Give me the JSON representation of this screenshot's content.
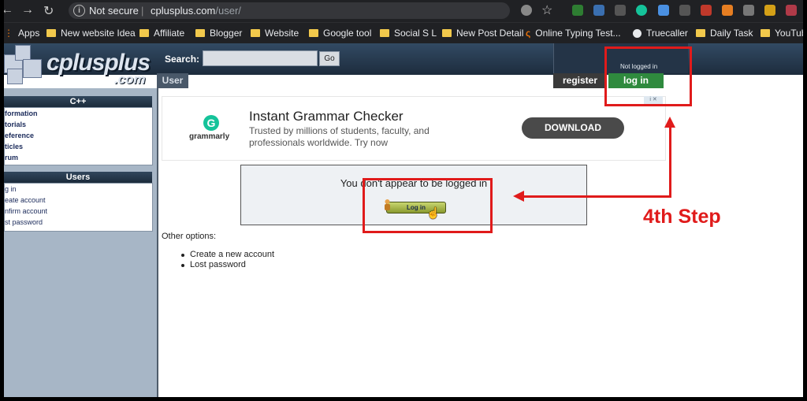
{
  "browser": {
    "security_label": "Not secure",
    "url_host": "cplusplus.com",
    "url_path": "/user/",
    "bookmarks": [
      {
        "label": "Apps",
        "icon": "apps-grid-icon"
      },
      {
        "label": "New website Idea",
        "icon": "folder-icon"
      },
      {
        "label": "Affiliate",
        "icon": "folder-icon"
      },
      {
        "label": "Blogger",
        "icon": "folder-icon"
      },
      {
        "label": "Website",
        "icon": "folder-icon"
      },
      {
        "label": "Google tool",
        "icon": "folder-icon"
      },
      {
        "label": "Social S L",
        "icon": "folder-icon"
      },
      {
        "label": "New Post Detail",
        "icon": "folder-icon"
      },
      {
        "label": "Online Typing Test...",
        "icon": "site-icon"
      },
      {
        "label": "Truecaller",
        "icon": "truecaller-icon"
      },
      {
        "label": "Daily Task",
        "icon": "folder-icon"
      },
      {
        "label": "YouTube",
        "icon": "folder-icon"
      }
    ]
  },
  "site": {
    "logo_text": "cplusplus",
    "logo_suffix": ".com",
    "search_label": "Search:",
    "search_value": "",
    "go_label": "Go",
    "section_tab": "User",
    "login_status": "Not logged in",
    "register_label": "register",
    "login_label": "log in"
  },
  "sidebar": {
    "cpp_heading": "C++",
    "cpp_items": [
      "formation",
      "torials",
      "eference",
      "ticles",
      "rum"
    ],
    "users_heading": "Users",
    "users_items": [
      "g in",
      "eate account",
      "nfirm account",
      "st password"
    ]
  },
  "ad": {
    "brand": "grammarly",
    "title": "Instant Grammar Checker",
    "description": "Trusted by millions of students, faculty, and professionals worldwide. Try now",
    "cta": "DOWNLOAD"
  },
  "main": {
    "notice_text": "You don't appear to be logged in",
    "login_button": "Log in",
    "other_options_label": "Other options:",
    "options": [
      "Create a new account",
      "Lost password"
    ]
  },
  "annotation": {
    "step_label": "4th Step",
    "color": "#e01b1b"
  }
}
